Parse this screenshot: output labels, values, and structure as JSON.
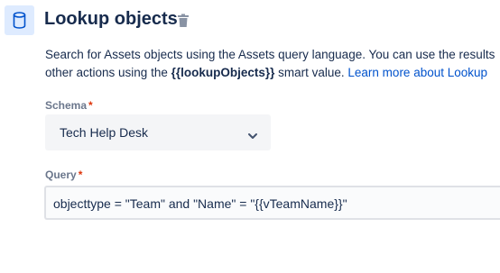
{
  "header": {
    "title": "Lookup objects",
    "icon": "database-icon",
    "delete_icon": "trash-icon"
  },
  "description": {
    "line1": "Search for Assets objects using the Assets query language. You can use the results",
    "line2_pre": "other actions using the ",
    "line2_bold": "{{lookupObjects}}",
    "line2_post": " smart value. ",
    "link_text": "Learn more about Lookup"
  },
  "schema": {
    "label": "Schema",
    "required_mark": "*",
    "value": "Tech Help Desk"
  },
  "query": {
    "label": "Query",
    "required_mark": "*",
    "value": "objecttype = \"Team\" and \"Name\" = \"{{vTeamName}}\""
  },
  "colors": {
    "accent": "#0052cc",
    "required": "#de350b",
    "icon_bg": "#deebff"
  }
}
